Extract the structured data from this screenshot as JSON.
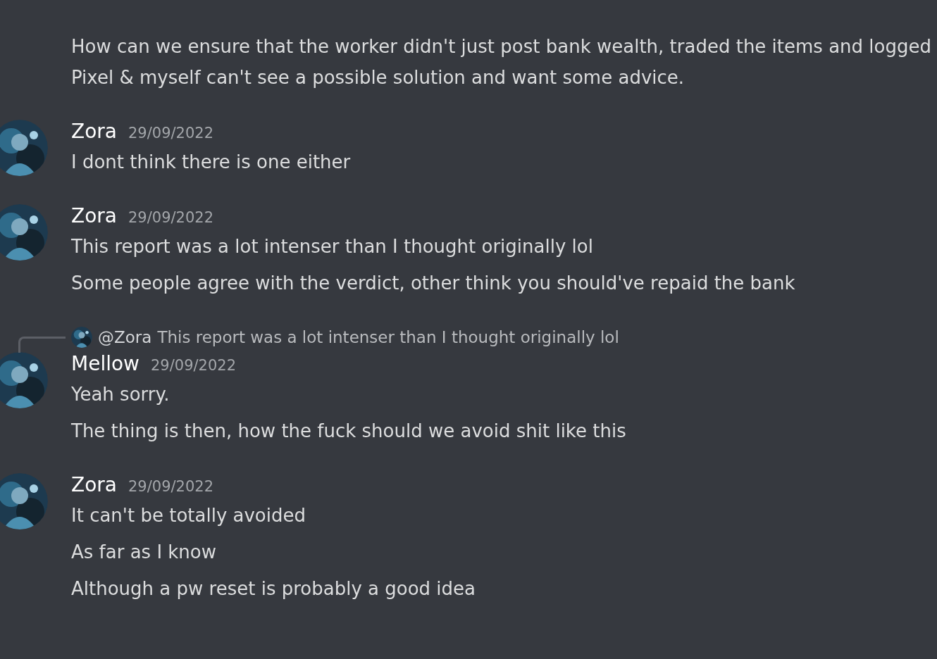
{
  "groups": [
    {
      "messages": [
        "How can we ensure that the worker didn't just post bank wealth, traded the items and logged",
        "Pixel & myself can't see a possible solution and want some advice."
      ]
    },
    {
      "author": "Zora",
      "timestamp": "29/09/2022",
      "messages": [
        "I dont think there is one either"
      ]
    },
    {
      "author": "Zora",
      "timestamp": "29/09/2022",
      "messages": [
        "This report was a lot intenser than I thought originally lol",
        "Some people agree with the verdict, other think you should've repaid the bank"
      ]
    },
    {
      "reply": {
        "mention": "@Zora",
        "text": "This report was a lot intenser than I thought originally lol"
      },
      "author": "Mellow",
      "timestamp": "29/09/2022",
      "messages": [
        "Yeah sorry.",
        "The thing is then, how the fuck should we avoid shit like this"
      ]
    },
    {
      "author": "Zora",
      "timestamp": "29/09/2022",
      "messages": [
        "It can't be totally avoided",
        "As far as I know",
        "Although a pw reset is probably a good idea"
      ]
    }
  ]
}
